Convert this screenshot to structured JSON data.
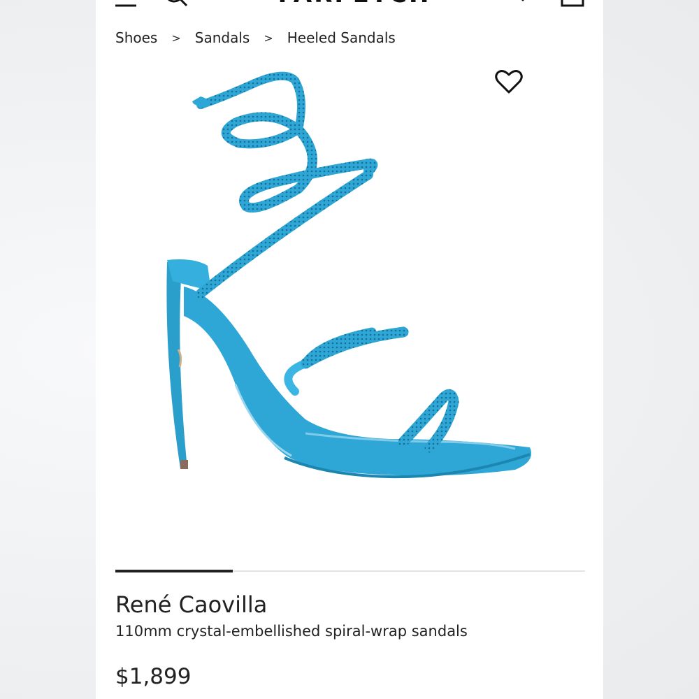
{
  "header": {
    "logo": "FARFETCH",
    "icons": [
      "menu-icon",
      "search-icon",
      "heart-icon",
      "bag-icon"
    ]
  },
  "breadcrumb": {
    "items": [
      "Shoes",
      "Sandals",
      "Heeled Sandals"
    ],
    "separator": ">"
  },
  "product": {
    "brand": "René Caovilla",
    "description": "110mm crystal-embellished spiral-wrap sandals",
    "price": "$1,899",
    "image_color": "#2ea7d6",
    "image_subject": "blue crystal spiral-wrap heeled sandal"
  },
  "carousel": {
    "progress": 0.25
  },
  "colors": {
    "accent": "#222222",
    "product_blue": "#2ea7d6"
  }
}
